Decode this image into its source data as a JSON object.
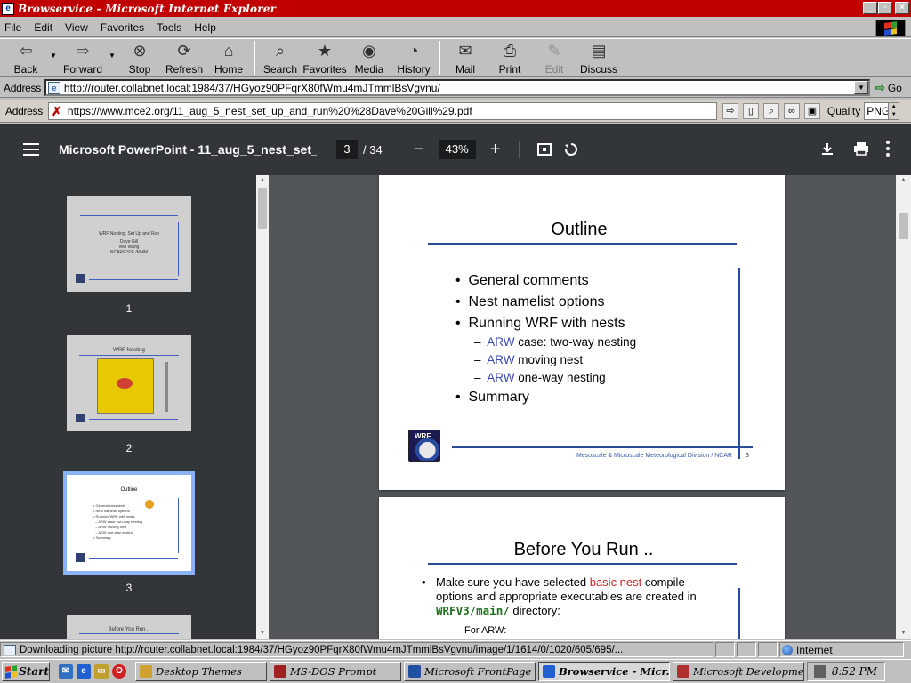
{
  "window": {
    "title": "Browservice - Microsoft Internet Explorer",
    "controls": {
      "minimize": "_",
      "maximize": "▫",
      "close": "×"
    }
  },
  "menubar": {
    "items": [
      {
        "label": "File",
        "key": "F"
      },
      {
        "label": "Edit",
        "key": "E"
      },
      {
        "label": "View",
        "key": "V"
      },
      {
        "label": "Favorites",
        "key": "a"
      },
      {
        "label": "Tools",
        "key": "T"
      },
      {
        "label": "Help",
        "key": "H"
      }
    ]
  },
  "toolbar": {
    "back": "Back",
    "forward": "Forward",
    "stop": "Stop",
    "refresh": "Refresh",
    "home": "Home",
    "search": "Search",
    "favorites": "Favorites",
    "media": "Media",
    "history": "History",
    "mail": "Mail",
    "print": "Print",
    "edit": "Edit",
    "discuss": "Discuss"
  },
  "addressbar": {
    "label": "Address",
    "url": "http://router.collabnet.local:1984/37/HGyoz90PFqrX80fWmu4mJTmmlBsVgvnu/",
    "go": "Go"
  },
  "inner_addressbar": {
    "label": "Address",
    "url": "https://www.mce2.org/11_aug_5_nest_set_up_and_run%20%28Dave%20Gill%29.pdf",
    "quality_label": "Quality",
    "quality_value": "PNG"
  },
  "pdf_viewer": {
    "title": "Microsoft PowerPoint - 11_aug_5_nest_set_...",
    "current_page": "3",
    "page_total": "/ 34",
    "zoom": "43%",
    "zoom_out": "−",
    "zoom_in": "+"
  },
  "thumbnails": [
    {
      "num": "1",
      "title": "WRF Nesting: Set Up and Run",
      "sub1": "Dave Gill",
      "sub2": "Wei Wang",
      "sub3": "NCAR/ESSL/MMM"
    },
    {
      "num": "2",
      "title": "WRF Nesting"
    },
    {
      "num": "3",
      "title": "Outline"
    },
    {
      "num": "4",
      "title": "Before You Run .."
    }
  ],
  "slide3": {
    "title": "Outline",
    "bullets": [
      "General comments",
      "Nest namelist options",
      "Running WRF with nests"
    ],
    "sub_bullets": [
      {
        "prefix": "ARW",
        "rest": " case: two-way nesting"
      },
      {
        "prefix": "ARW",
        "rest": " moving nest"
      },
      {
        "prefix": "ARW",
        "rest": " one-way nesting"
      }
    ],
    "last_bullet": "Summary",
    "footer": "Mesoscale & Microscale Meteorological Division / NCAR",
    "page_number": "3",
    "logo_text": "WRF"
  },
  "slide4": {
    "title": "Before You Run ..",
    "bullet_part1": "Make sure you have selected ",
    "bullet_red": "basic nest",
    "bullet_part2": " compile",
    "bullet_line2": "options and appropriate executables are created in",
    "bullet_code": "WRFV3/main/",
    "bullet_line3_rest": " directory:",
    "for_arw": "For ARW:"
  },
  "statusbar": {
    "text": "Downloading picture http://router.collabnet.local:1984/37/HGyoz90PFqrX80fWmu4mJTmmlBsVgvnu/image/1/1614/0/1020/605/695/...",
    "zone": "Internet"
  },
  "taskbar": {
    "start": "Start",
    "tasks": [
      {
        "label": "Desktop Themes",
        "active": false
      },
      {
        "label": "MS-DOS Prompt",
        "active": false
      },
      {
        "label": "Microsoft FrontPage - C...",
        "active": false
      },
      {
        "label": "Browservice - Micr...",
        "active": true
      },
      {
        "label": "Microsoft Development ...",
        "active": false
      }
    ],
    "clock": "8:52 PM"
  }
}
